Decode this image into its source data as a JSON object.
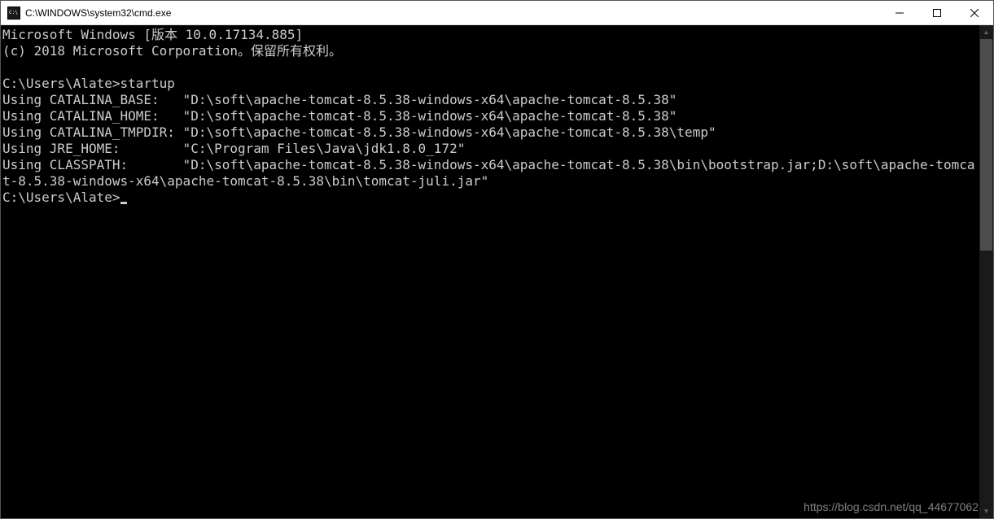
{
  "window": {
    "title": "C:\\WINDOWS\\system32\\cmd.exe"
  },
  "terminal": {
    "lines": [
      "Microsoft Windows [版本 10.0.17134.885]",
      "(c) 2018 Microsoft Corporation。保留所有权利。",
      "",
      "C:\\Users\\Alate>startup",
      "Using CATALINA_BASE:   \"D:\\soft\\apache-tomcat-8.5.38-windows-x64\\apache-tomcat-8.5.38\"",
      "Using CATALINA_HOME:   \"D:\\soft\\apache-tomcat-8.5.38-windows-x64\\apache-tomcat-8.5.38\"",
      "Using CATALINA_TMPDIR: \"D:\\soft\\apache-tomcat-8.5.38-windows-x64\\apache-tomcat-8.5.38\\temp\"",
      "Using JRE_HOME:        \"C:\\Program Files\\Java\\jdk1.8.0_172\"",
      "Using CLASSPATH:       \"D:\\soft\\apache-tomcat-8.5.38-windows-x64\\apache-tomcat-8.5.38\\bin\\bootstrap.jar;D:\\soft\\apache-tomcat-8.5.38-windows-x64\\apache-tomcat-8.5.38\\bin\\tomcat-juli.jar\""
    ],
    "prompt": "C:\\Users\\Alate>"
  },
  "watermark": "https://blog.csdn.net/qq_44677062"
}
